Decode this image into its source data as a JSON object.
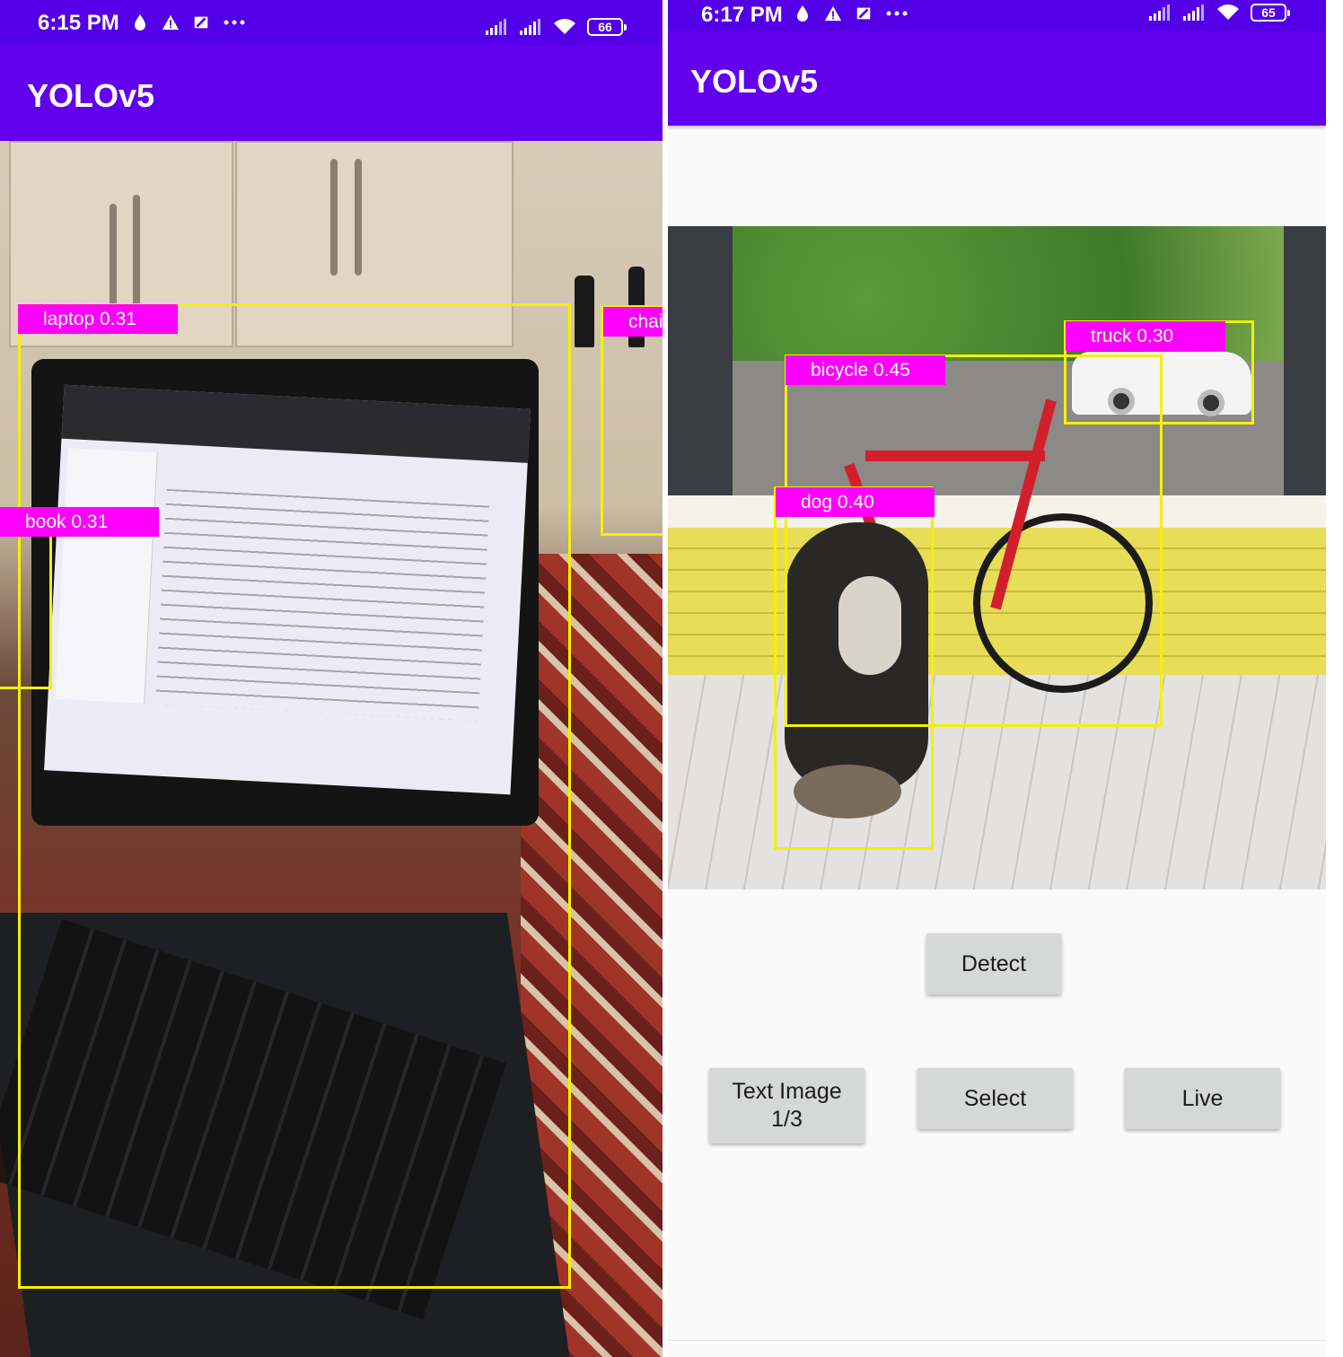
{
  "left_screen": {
    "status_bar": {
      "time": "6:15 PM",
      "battery": "66",
      "icons": [
        "drop-icon",
        "warning-icon",
        "card-icon",
        "more-dots-icon",
        "signal-icon",
        "signal-icon",
        "wifi-icon",
        "battery-icon"
      ]
    },
    "app_title": "YOLOv5",
    "detections": [
      {
        "label": "laptop 0.31"
      },
      {
        "label": "book 0.31"
      },
      {
        "label": "chai"
      }
    ]
  },
  "right_screen": {
    "status_bar": {
      "time": "6:17 PM",
      "battery": "65",
      "icons": [
        "drop-icon",
        "warning-icon",
        "card-icon",
        "more-dots-icon",
        "signal-icon",
        "signal-icon",
        "wifi-icon",
        "battery-icon"
      ]
    },
    "app_title": "YOLOv5",
    "detections": [
      {
        "label": "bicycle 0.45"
      },
      {
        "label": "truck 0.30"
      },
      {
        "label": "dog 0.40"
      }
    ],
    "buttons": {
      "detect": "Detect",
      "test_image_line1": "Text Image",
      "test_image_line2": "1/3",
      "select": "Select",
      "live": "Live"
    }
  },
  "colors": {
    "status_bar": "#5300e8",
    "app_bar": "#6200ee",
    "box": "#f6f000",
    "label_bg": "#ff00ff",
    "button": "#d6d7d7"
  }
}
